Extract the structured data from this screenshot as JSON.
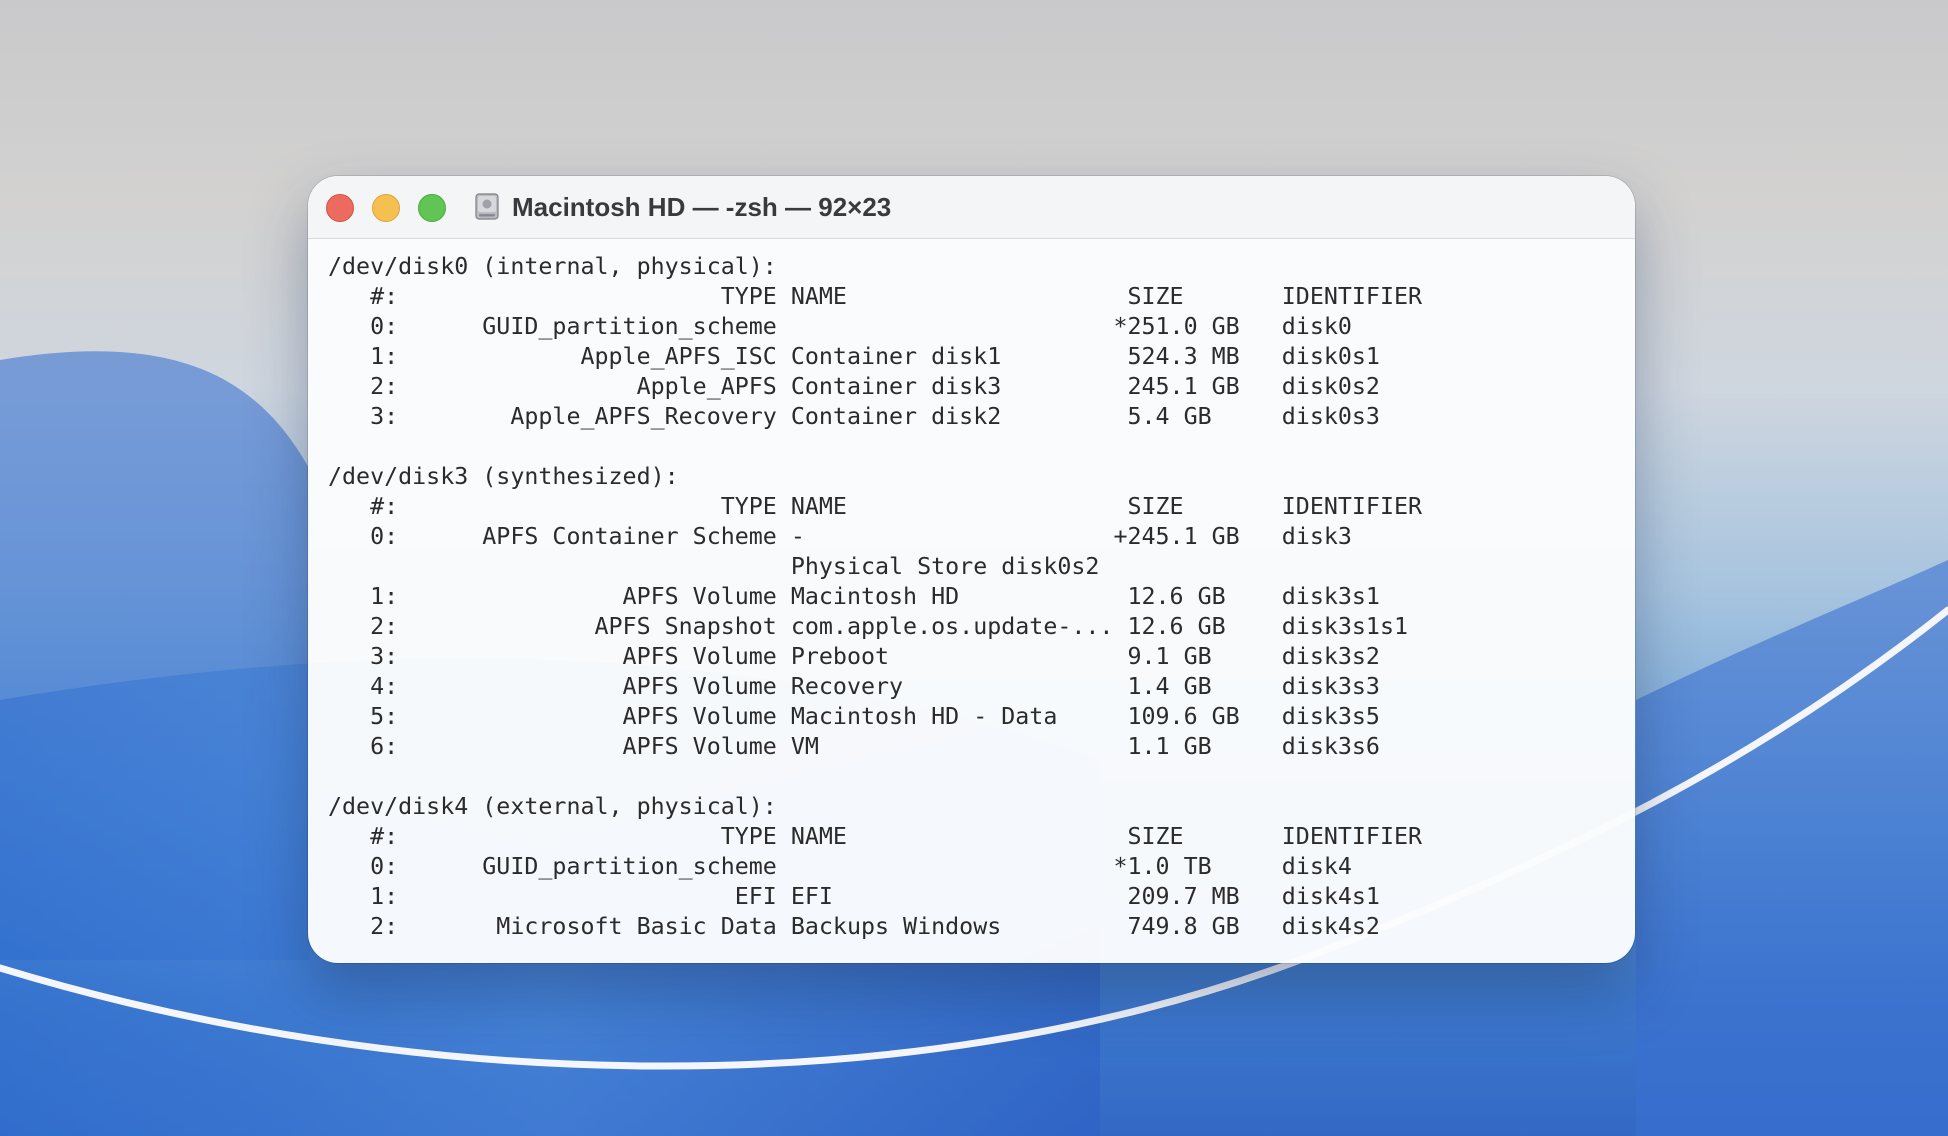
{
  "window": {
    "title": "Macintosh HD — -zsh — 92×23",
    "icon": "hard-drive-icon"
  },
  "terminal": {
    "lines": [
      "/dev/disk0 (internal, physical):",
      "   #:                       TYPE NAME                    SIZE       IDENTIFIER",
      "   0:      GUID_partition_scheme                        *251.0 GB   disk0",
      "   1:             Apple_APFS_ISC Container disk1         524.3 MB   disk0s1",
      "   2:                 Apple_APFS Container disk3         245.1 GB   disk0s2",
      "   3:        Apple_APFS_Recovery Container disk2         5.4 GB     disk0s3",
      "",
      "/dev/disk3 (synthesized):",
      "   #:                       TYPE NAME                    SIZE       IDENTIFIER",
      "   0:      APFS Container Scheme -                      +245.1 GB   disk3",
      "                                 Physical Store disk0s2",
      "   1:                APFS Volume Macintosh HD            12.6 GB    disk3s1",
      "   2:              APFS Snapshot com.apple.os.update-... 12.6 GB    disk3s1s1",
      "   3:                APFS Volume Preboot                 9.1 GB     disk3s2",
      "   4:                APFS Volume Recovery                1.4 GB     disk3s3",
      "   5:                APFS Volume Macintosh HD - Data     109.6 GB   disk3s5",
      "   6:                APFS Volume VM                      1.1 GB     disk3s6",
      "",
      "/dev/disk4 (external, physical):",
      "   #:                       TYPE NAME                    SIZE       IDENTIFIER",
      "   0:      GUID_partition_scheme                        *1.0 TB     disk4",
      "   1:                        EFI EFI                     209.7 MB   disk4s1",
      "   2:       Microsoft Basic Data Backups Windows         749.8 GB   disk4s2"
    ]
  }
}
